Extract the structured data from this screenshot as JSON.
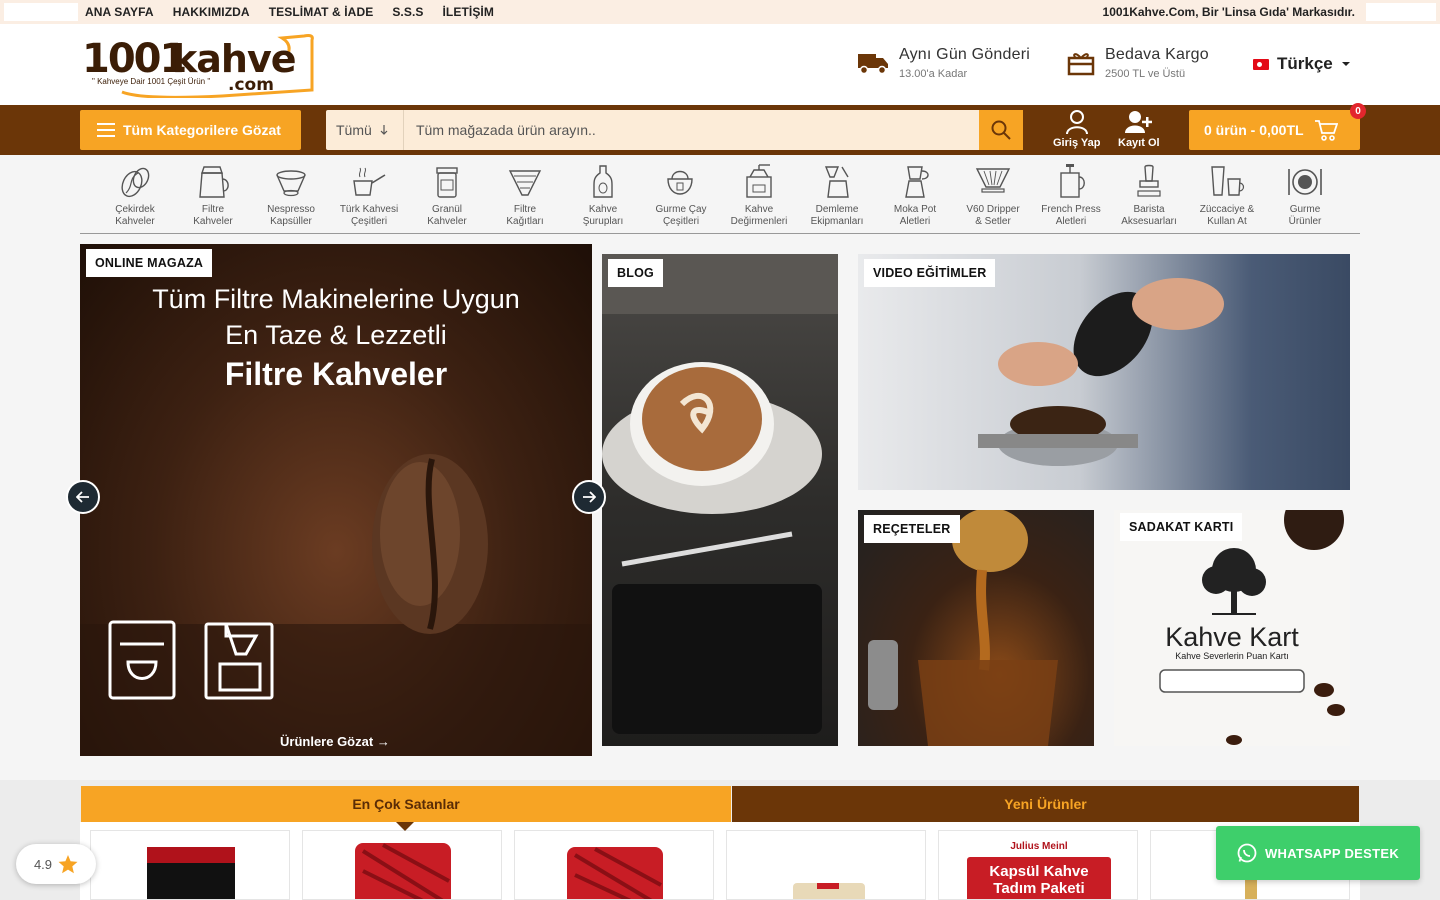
{
  "topbar": {
    "nav": [
      "ANA SAYFA",
      "HAKKIMIZDA",
      "TESLİMAT & İADE",
      "S.S.S",
      "İLETİŞİM"
    ],
    "right_text": "1001Kahve.Com, Bir 'Linsa Gıda' Markasıdır."
  },
  "header": {
    "logo_main": "1001kahve",
    "logo_tld": ".com",
    "logo_slogan": "\" Kahveye Dair 1001 Çeşit Ürün \"",
    "features": [
      {
        "title": "Aynı Gün Gönderi",
        "sub": "13.00'a Kadar",
        "icon": "truck-icon"
      },
      {
        "title": "Bedava Kargo",
        "sub": "2500 TL ve Üstü",
        "icon": "gift-box-icon"
      }
    ],
    "language": "Türkçe"
  },
  "nav": {
    "categories_button": "Tüm Kategorilere Gözat",
    "search_select": "Tümü",
    "search_placeholder": "Tüm mağazada ürün arayın..",
    "login": "Giriş Yap",
    "register": "Kayıt Ol",
    "cart": "0 ürün - 0,00TL",
    "cart_badge": "0"
  },
  "categories": [
    {
      "l1": "Çekirdek",
      "l2": "Kahveler",
      "icon": "coffee-bean-icon"
    },
    {
      "l1": "Filtre",
      "l2": "Kahveler",
      "icon": "coffee-pot-icon"
    },
    {
      "l1": "Nespresso",
      "l2": "Kapsüller",
      "icon": "capsule-icon"
    },
    {
      "l1": "Türk Kahvesi",
      "l2": "Çeşitleri",
      "icon": "cezve-icon"
    },
    {
      "l1": "Granül",
      "l2": "Kahveler",
      "icon": "instant-coffee-icon"
    },
    {
      "l1": "Filtre",
      "l2": "Kağıtları",
      "icon": "filter-paper-icon"
    },
    {
      "l1": "Kahve",
      "l2": "Şurupları",
      "icon": "syrup-bottle-icon"
    },
    {
      "l1": "Gurme Çay",
      "l2": "Çeşitleri",
      "icon": "teapot-icon"
    },
    {
      "l1": "Kahve",
      "l2": "Değirmenleri",
      "icon": "grinder-icon"
    },
    {
      "l1": "Demleme",
      "l2": "Ekipmanları",
      "icon": "brewing-icon"
    },
    {
      "l1": "Moka Pot",
      "l2": "Aletleri",
      "icon": "moka-pot-icon"
    },
    {
      "l1": "V60 Dripper",
      "l2": "& Setler",
      "icon": "dripper-icon"
    },
    {
      "l1": "French Press",
      "l2": "Aletleri",
      "icon": "french-press-icon"
    },
    {
      "l1": "Barista",
      "l2": "Aksesuarları",
      "icon": "tamper-icon"
    },
    {
      "l1": "Züccaciye &",
      "l2": "Kullan At",
      "icon": "cups-icon"
    },
    {
      "l1": "Gurme",
      "l2": "Ürünler",
      "icon": "gourmet-icon"
    }
  ],
  "banners": {
    "hero": {
      "tag": "ONLINE MAGAZA",
      "line1": "Tüm Filtre Makinelerine Uygun",
      "line2": "En Taze & Lezzetli",
      "line3": "Filtre Kahveler",
      "cta": "Ürünlere Gözat"
    },
    "blog": {
      "tag": "BLOG"
    },
    "video": {
      "tag": "VIDEO EĞİTİMLER"
    },
    "recipe": {
      "tag": "REÇETELER"
    },
    "loyalty": {
      "tag": "SADAKAT KARTI",
      "brand": "Kahve Kart",
      "sub": "Kahve Severlerin Puan Kartı"
    }
  },
  "tabs": {
    "best": "En Çok Satanlar",
    "new": "Yeni Ürünler"
  },
  "products": [
    {
      "label": ""
    },
    {
      "label": ""
    },
    {
      "label": ""
    },
    {
      "label": ""
    },
    {
      "brand": "Julius Meinl",
      "label": "Kapsül Kahve Tadım Paketi"
    },
    {
      "label": ""
    }
  ],
  "rating": {
    "value": "4.9"
  },
  "whatsapp": {
    "label": "WHATSAPP DESTEK"
  },
  "colors": {
    "accent": "#f7a424",
    "brown": "#6b3608",
    "whatsapp": "#3ecf6b"
  }
}
